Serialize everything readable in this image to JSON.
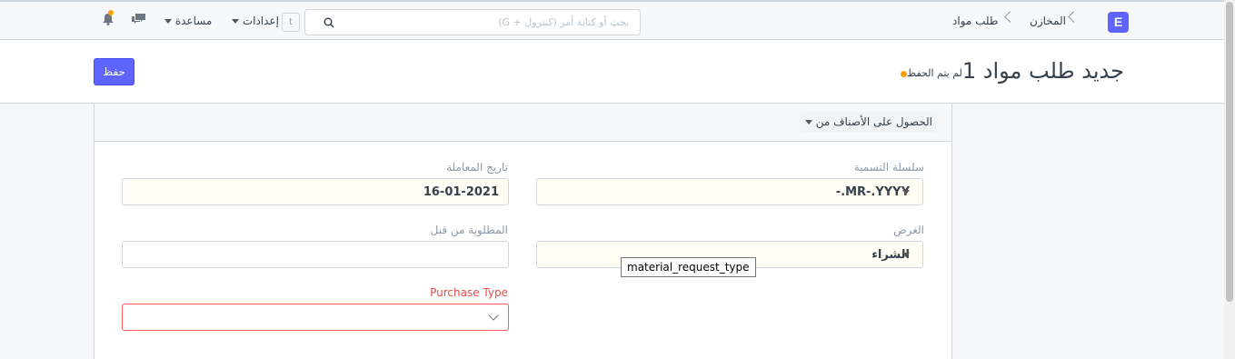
{
  "navbar": {
    "brand_letter": "E",
    "breadcrumbs": [
      {
        "label": "المخازن"
      },
      {
        "label": "طلب مواد"
      }
    ],
    "search_placeholder": "بحث أو كتابة أمر (كنترول + G)",
    "search_shortcut": "t",
    "settings_label": "إعدادات",
    "help_label": "مساعدة",
    "notification_dot_color": "#ffa00a"
  },
  "page": {
    "title": "جديد طلب مواد 1",
    "status": "لم يتم الحفظ",
    "save_label": "حفظ"
  },
  "toolbar": {
    "get_items_label": "الحصول على الأصناف من"
  },
  "form": {
    "naming_series": {
      "label": "سلسلة التسمية",
      "value": "MR-.YYYY.-"
    },
    "transaction_date": {
      "label": "تاريخ المعاملة",
      "value": "16-01-2021"
    },
    "purpose": {
      "label": "الغرض",
      "value": "الشراء"
    },
    "schedule_date": {
      "label": "المطلوبة من قبل",
      "value": ""
    },
    "purchase_type": {
      "label": "Purchase Type",
      "value": ""
    }
  },
  "tooltip": "material_request_type",
  "colors": {
    "primary": "#5e64ff",
    "error": "#ff5858",
    "indicator": "#ffa00a"
  }
}
